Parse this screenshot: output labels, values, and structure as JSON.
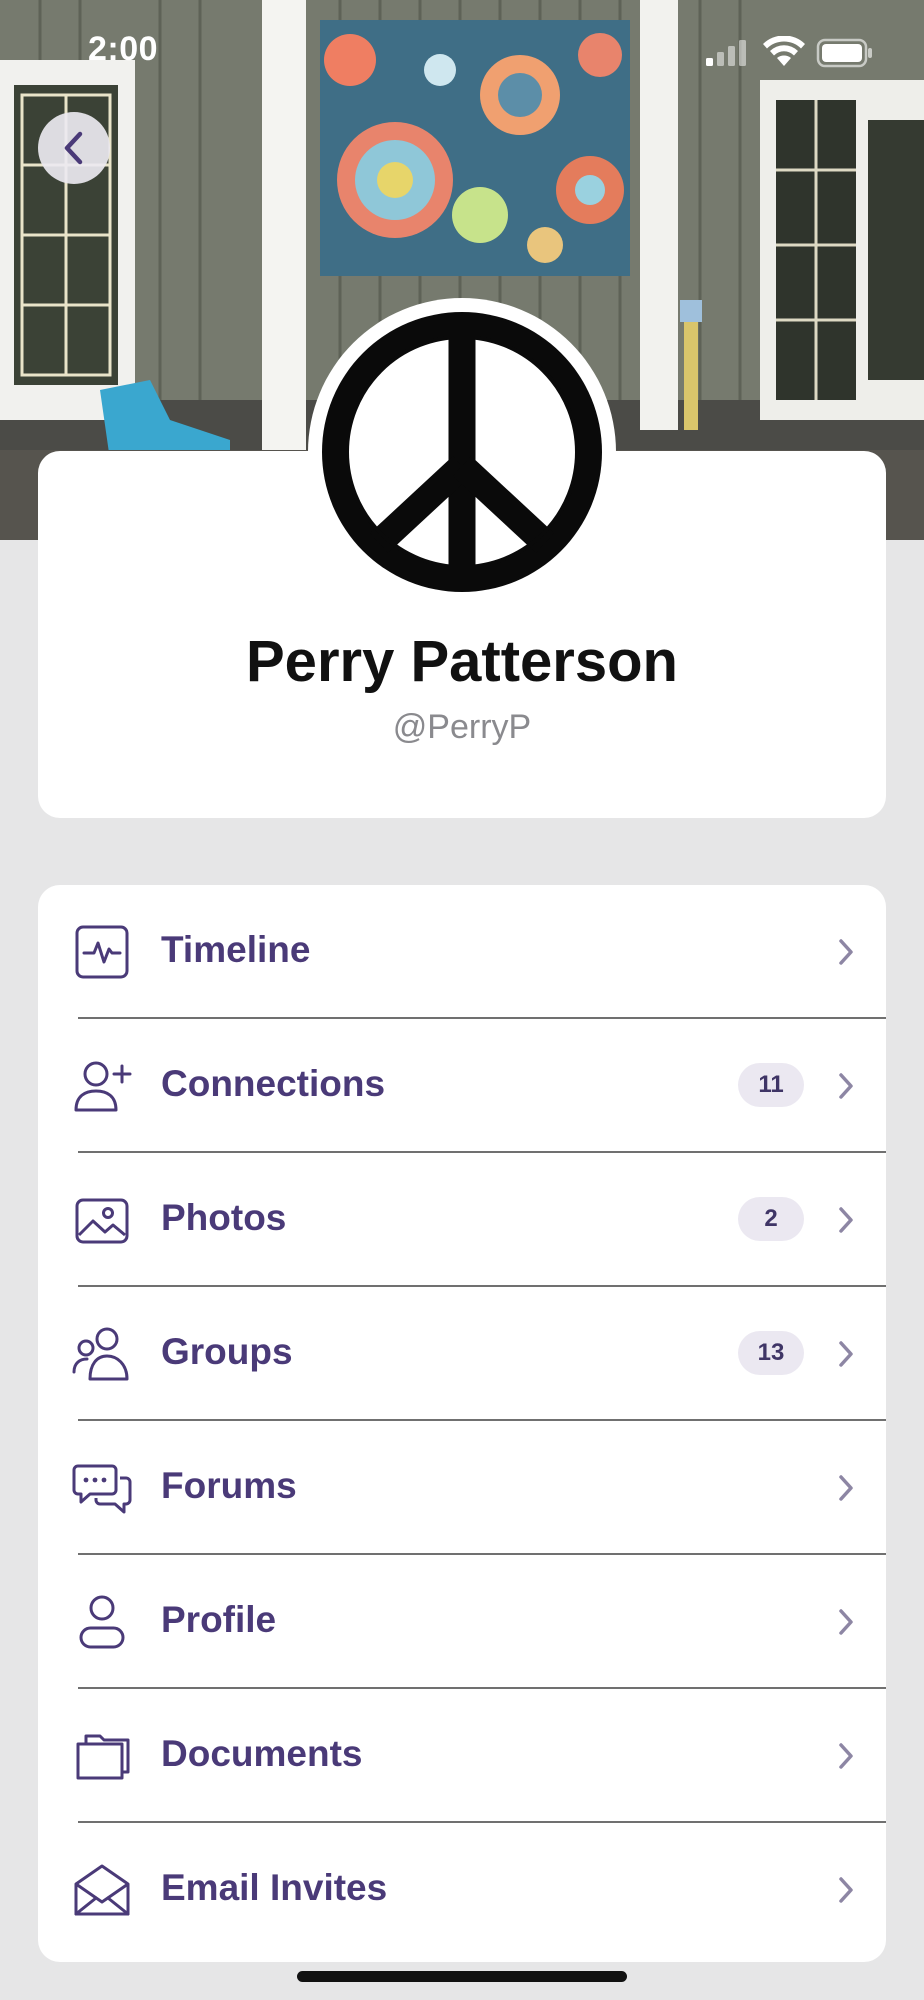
{
  "status_bar": {
    "time": "2:00"
  },
  "profile": {
    "name": "Perry Patterson",
    "handle": "@PerryP"
  },
  "menu": {
    "items": [
      {
        "label": "Timeline",
        "badge": "",
        "icon": "activity-icon"
      },
      {
        "label": "Connections",
        "badge": "11",
        "icon": "add-user-icon"
      },
      {
        "label": "Photos",
        "badge": "2",
        "icon": "photo-icon"
      },
      {
        "label": "Groups",
        "badge": "13",
        "icon": "group-icon"
      },
      {
        "label": "Forums",
        "badge": "",
        "icon": "chat-bubbles-icon"
      },
      {
        "label": "Profile",
        "badge": "",
        "icon": "user-icon"
      },
      {
        "label": "Documents",
        "badge": "",
        "icon": "folder-icon"
      },
      {
        "label": "Email Invites",
        "badge": "",
        "icon": "envelope-icon"
      }
    ]
  },
  "colors": {
    "accent": "#4a3a78",
    "badge_bg": "#ebe8f1",
    "background": "#e6e6e7",
    "chevron": "#8d86a4"
  }
}
